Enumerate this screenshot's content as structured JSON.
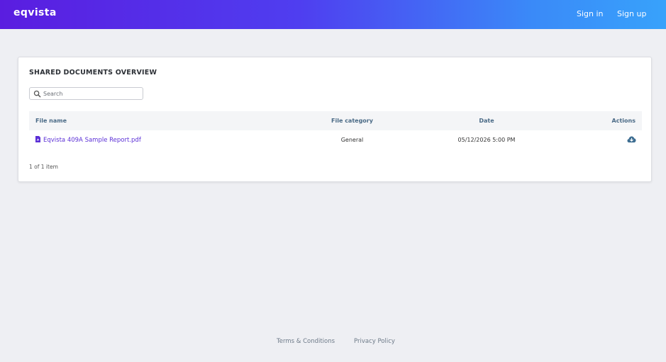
{
  "header": {
    "logo": "eqvista",
    "sign_in": "Sign in",
    "sign_up": "Sign up",
    "gradient_colors": [
      "#5a1de0",
      "#38a2fb"
    ]
  },
  "card": {
    "title": "SHARED DOCUMENTS OVERVIEW",
    "search": {
      "placeholder": "Search",
      "value": ""
    },
    "table": {
      "columns": [
        "File name",
        "File category",
        "Date",
        "Actions"
      ],
      "rows": [
        {
          "file_name": "Eqvista 409A Sample Report.pdf",
          "category": "General",
          "date": "05/12/2026 5:00 PM",
          "action_icon": "cloud-download-icon"
        }
      ]
    },
    "pager": "1 of 1 item"
  },
  "footer": {
    "terms": "Terms & Conditions",
    "privacy": "Privacy Policy"
  },
  "colors": {
    "link": "#5b2fd6",
    "header_text": "#4a6a86",
    "action_icon": "#3d6d91"
  }
}
